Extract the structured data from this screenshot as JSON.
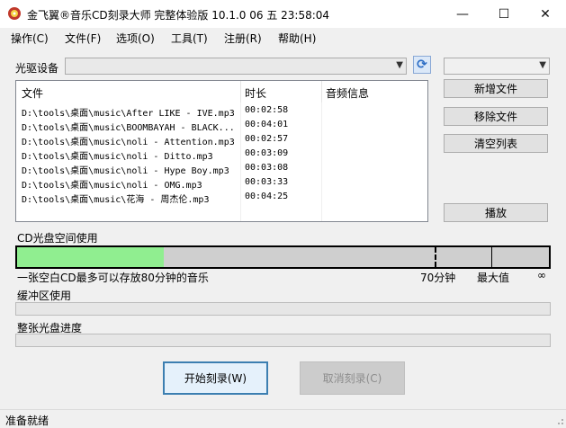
{
  "window": {
    "title": "金飞翼®音乐CD刻录大师 完整体验版 10.1.0 06 五 23:58:04",
    "controls": {
      "minimize": "—",
      "maximize": "☐",
      "close": "✕"
    }
  },
  "menu": [
    "操作(C)",
    "文件(F)",
    "选项(O)",
    "工具(T)",
    "注册(R)",
    "帮助(H)"
  ],
  "drive": {
    "label": "光驱设备",
    "value": "",
    "speed_value": ""
  },
  "file_list": {
    "columns": [
      "文件",
      "时长",
      "音频信息"
    ],
    "rows": [
      {
        "file": "D:\\tools\\桌面\\music\\After LIKE - IVE.mp3",
        "duration": "00:02:58",
        "info": ""
      },
      {
        "file": "D:\\tools\\桌面\\music\\BOOMBAYAH - BLACK...",
        "duration": "00:04:01",
        "info": ""
      },
      {
        "file": "D:\\tools\\桌面\\music\\noli - Attention.mp3",
        "duration": "00:02:57",
        "info": ""
      },
      {
        "file": "D:\\tools\\桌面\\music\\noli - Ditto.mp3",
        "duration": "00:03:09",
        "info": ""
      },
      {
        "file": "D:\\tools\\桌面\\music\\noli - Hype Boy.mp3",
        "duration": "00:03:08",
        "info": ""
      },
      {
        "file": "D:\\tools\\桌面\\music\\noli - OMG.mp3",
        "duration": "00:03:33",
        "info": ""
      },
      {
        "file": "D:\\tools\\桌面\\music\\花海 - 周杰伦.mp3",
        "duration": "00:04:25",
        "info": ""
      }
    ]
  },
  "side_buttons": {
    "add": "新增文件",
    "remove": "移除文件",
    "clear": "清空列表",
    "play": "播放"
  },
  "cd_space": {
    "label": "CD光盘空间使用",
    "used_fraction": 0.276,
    "caption": "一张空白CD最多可以存放80分钟的音乐",
    "mark_70": "70分钟",
    "mark_max": "最大值",
    "mark_inf": "∞",
    "colors": {
      "used": "#90ee90",
      "free": "#cfcfcf"
    }
  },
  "buffer": {
    "label": "缓冲区使用"
  },
  "progress": {
    "label": "整张光盘进度"
  },
  "actions": {
    "start": "开始刻录(W)",
    "cancel": "取消刻录(C)"
  },
  "status": "准备就绪"
}
